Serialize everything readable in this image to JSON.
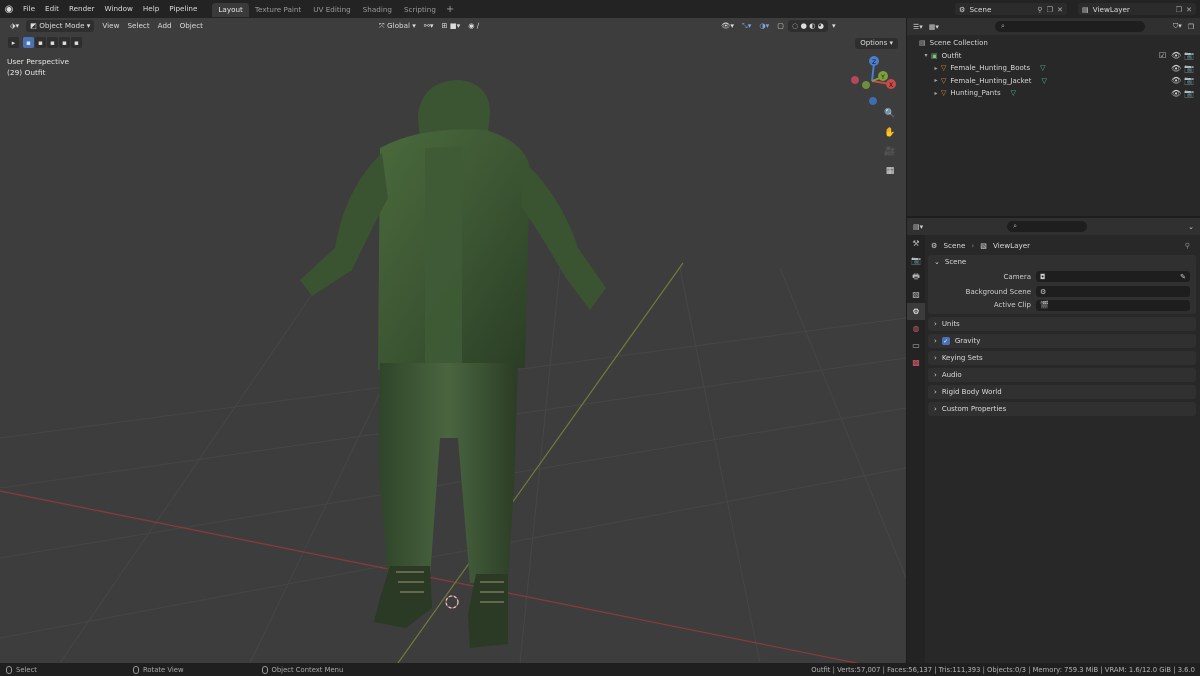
{
  "menu": [
    "File",
    "Edit",
    "Render",
    "Window",
    "Help",
    "Pipeline"
  ],
  "workspaces": [
    "Layout",
    "Texture Paint",
    "UV Editing",
    "Shading",
    "Scripting"
  ],
  "active_workspace": "Layout",
  "scene_name": "Scene",
  "view_layer_name": "ViewLayer",
  "viewport": {
    "mode": "Object Mode",
    "menus": [
      "View",
      "Select",
      "Add",
      "Object"
    ],
    "orientation": "Global",
    "options_label": "Options",
    "view_name": "User Perspective",
    "object_info": "(29) Outfit",
    "gizmo": {
      "z": "Z",
      "y": "Y",
      "x": "X"
    }
  },
  "outliner": {
    "root": "Scene Collection",
    "collection": "Outfit",
    "objects": [
      "Female_Hunting_Boots",
      "Female_Hunting_Jacket",
      "Hunting_Pants"
    ]
  },
  "properties": {
    "breadcrumb": [
      "Scene",
      "ViewLayer"
    ],
    "panel_title": "Scene",
    "fields": [
      {
        "label": "Camera",
        "value": ""
      },
      {
        "label": "Background Scene",
        "value": ""
      },
      {
        "label": "Active Clip",
        "value": ""
      }
    ],
    "subpanels": [
      "Units",
      "Gravity",
      "Keying Sets",
      "Audio",
      "Rigid Body World",
      "Custom Properties"
    ]
  },
  "status": {
    "select": "Select",
    "rotate": "Rotate View",
    "context": "Object Context Menu",
    "stats": "Outfit | Verts:57,007 | Faces:56,137 | Tris:111,393 | Objects:0/3 | Memory: 759.3 MiB | VRAM: 1.6/12.0 GiB | 3.6.0"
  },
  "colors": {
    "viewport_bg": "#3d3d3d",
    "accent": "#4772b3",
    "outfit_green": "#3f5a35",
    "x_axis": "#c84a4a",
    "y_axis": "#7fa03a",
    "z_axis": "#4a7fd0"
  }
}
